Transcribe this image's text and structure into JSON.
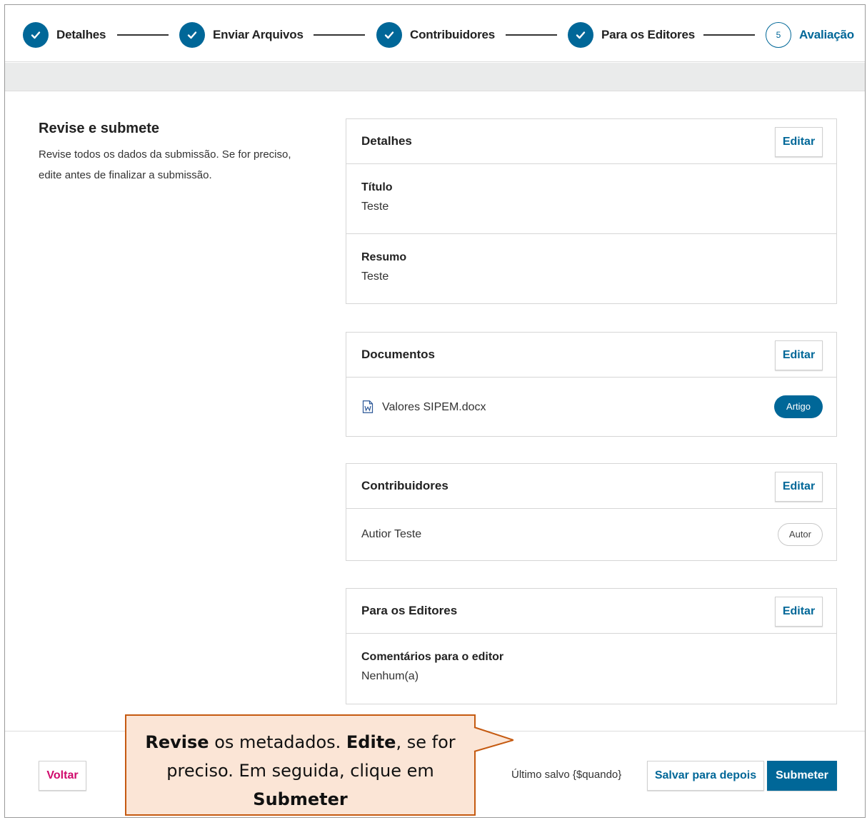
{
  "stepper": {
    "steps": [
      {
        "label": "Detalhes",
        "status": "done"
      },
      {
        "label": "Enviar Arquivos",
        "status": "done"
      },
      {
        "label": "Contribuidores",
        "status": "done"
      },
      {
        "label": "Para os Editores",
        "status": "done"
      },
      {
        "label": "Avaliação",
        "status": "current",
        "number": "5"
      }
    ]
  },
  "intro": {
    "title": "Revise e submete",
    "text_line1": "Revise todos os dados da submissão. Se for preciso,",
    "text_line2": "edite antes de finalizar a submissão."
  },
  "cards": {
    "details": {
      "title": "Detalhes",
      "edit_label": "Editar",
      "fields": [
        {
          "label": "Título",
          "value": "Teste"
        },
        {
          "label": "Resumo",
          "value": "Teste"
        }
      ]
    },
    "documents": {
      "title": "Documentos",
      "edit_label": "Editar",
      "file_name": "Valores SIPEM.docx",
      "file_icon": "word-document-icon",
      "file_type_badge": "Artigo"
    },
    "contributors": {
      "title": "Contribuidores",
      "edit_label": "Editar",
      "name": "Autior Teste",
      "role_badge": "Autor"
    },
    "editors": {
      "title": "Para os Editores",
      "edit_label": "Editar",
      "field_label": "Comentários para o editor",
      "field_value": "Nenhum(a)"
    }
  },
  "footer": {
    "back_label": "Voltar",
    "last_saved": "Último salvo {$quando}",
    "save_later_label": "Salvar para depois",
    "submit_label": "Submeter"
  },
  "callout": {
    "part1_bold": "Revise",
    "part1": " os metadados. ",
    "part2_bold": "Edite",
    "part2": ", se for",
    "line2": "preciso. Em seguida, clique em",
    "line3_bold": "Submeter"
  },
  "colors": {
    "primary": "#006798",
    "back_button": "#d00a6c",
    "callout_fill": "#fbe5d6",
    "callout_border": "#c55a11"
  }
}
